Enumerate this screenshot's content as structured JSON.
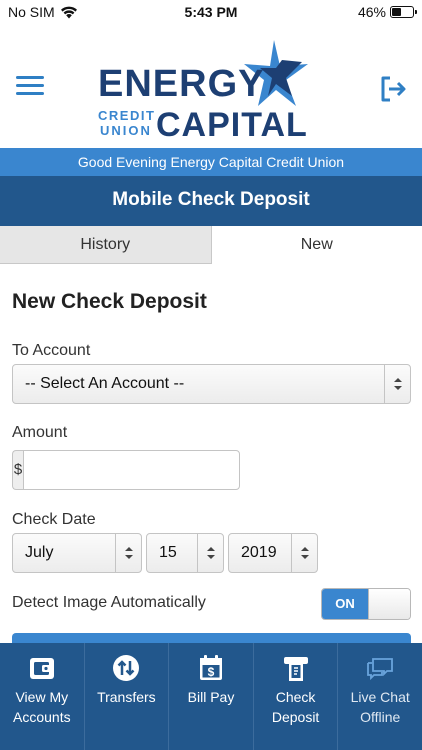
{
  "status_bar": {
    "carrier": "No SIM",
    "time": "5:43 PM",
    "battery": "46%",
    "battery_level": 0.46
  },
  "header": {
    "logo_text_top": "ENERGY",
    "logo_text_small_1": "CREDIT",
    "logo_text_small_2": "UNION",
    "logo_text_bottom": "CAPITAL",
    "menu_icon": "hamburger-icon",
    "logout_icon": "logout-icon"
  },
  "greeting": "Good Evening Energy Capital Credit Union",
  "page_title": "Mobile Check Deposit",
  "tabs": [
    {
      "label": "History",
      "active": false
    },
    {
      "label": "New",
      "active": true
    }
  ],
  "form": {
    "title": "New Check Deposit",
    "to_account_label": "To Account",
    "to_account_value": "-- Select An Account --",
    "amount_label": "Amount",
    "amount_prefix": "$",
    "amount_value": "",
    "check_date_label": "Check Date",
    "check_date": {
      "month": "July",
      "day": "15",
      "year": "2019"
    },
    "detect_label": "Detect Image Automatically",
    "detect_toggle": "ON"
  },
  "colors": {
    "primary_blue": "#3a86cf",
    "dark_blue": "#22578c",
    "logo_navy": "#1d3f73",
    "logo_blue": "#3a86cf"
  },
  "bottom_nav": [
    {
      "line1": "View My",
      "line2": "Accounts",
      "icon": "wallet-icon"
    },
    {
      "line1": "Transfers",
      "line2": "",
      "icon": "transfer-arrows-icon"
    },
    {
      "line1": "Bill Pay",
      "line2": "",
      "icon": "calendar-dollar-icon"
    },
    {
      "line1": "Check",
      "line2": "Deposit",
      "icon": "check-deposit-icon"
    },
    {
      "line1": "Live Chat",
      "line2": "Offline",
      "icon": "chat-icon"
    }
  ]
}
